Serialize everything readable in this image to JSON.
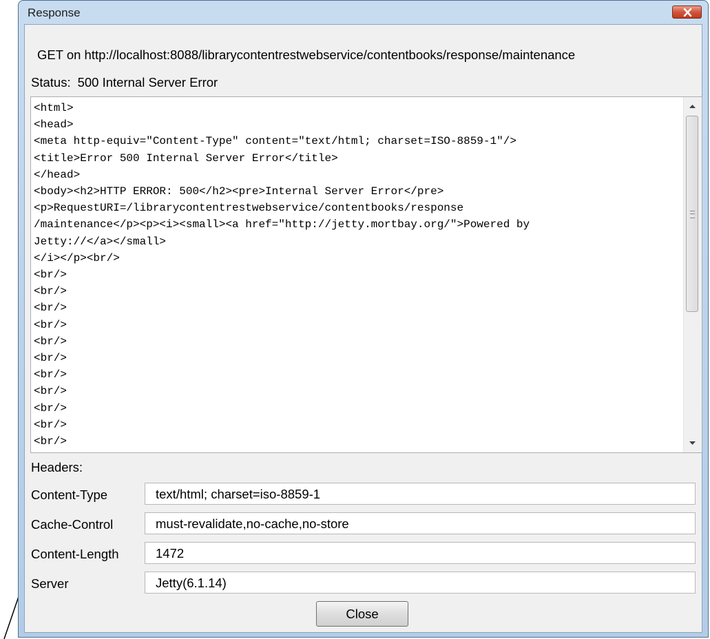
{
  "window": {
    "title": "Response"
  },
  "request_line": "GET on http://localhost:8088/librarycontentrestwebservice/contentbooks/response/maintenance",
  "status": {
    "label": "Status:",
    "value": "500 Internal Server Error"
  },
  "response_body": "<html>\n<head>\n<meta http-equiv=\"Content-Type\" content=\"text/html; charset=ISO-8859-1\"/>\n<title>Error 500 Internal Server Error</title>\n</head>\n<body><h2>HTTP ERROR: 500</h2><pre>Internal Server Error</pre>\n<p>RequestURI=/librarycontentrestwebservice/contentbooks/response\n/maintenance</p><p><i><small><a href=\"http://jetty.mortbay.org/\">Powered by\nJetty://</a></small>\n</i></p><br/>\n<br/>\n<br/>\n<br/>\n<br/>\n<br/>\n<br/>\n<br/>\n<br/>\n<br/>\n<br/>\n<br/>",
  "headers": {
    "label": "Headers:",
    "rows": [
      {
        "name": "Content-Type",
        "value": "text/html; charset=iso-8859-1"
      },
      {
        "name": "Cache-Control",
        "value": "must-revalidate,no-cache,no-store"
      },
      {
        "name": "Content-Length",
        "value": "1472"
      },
      {
        "name": "Server",
        "value": "Jetty(6.1.14)"
      }
    ]
  },
  "buttons": {
    "close_label": "Close"
  },
  "icons": {
    "window_close": "close-x-icon",
    "scroll_up": "arrow-up-icon",
    "scroll_down": "arrow-down-icon",
    "scroll_grip": "grip-icon"
  },
  "colors": {
    "titlebar": "#c8dcf0",
    "close_button": "#c0391e",
    "dialog_background": "#f0f0f0"
  }
}
